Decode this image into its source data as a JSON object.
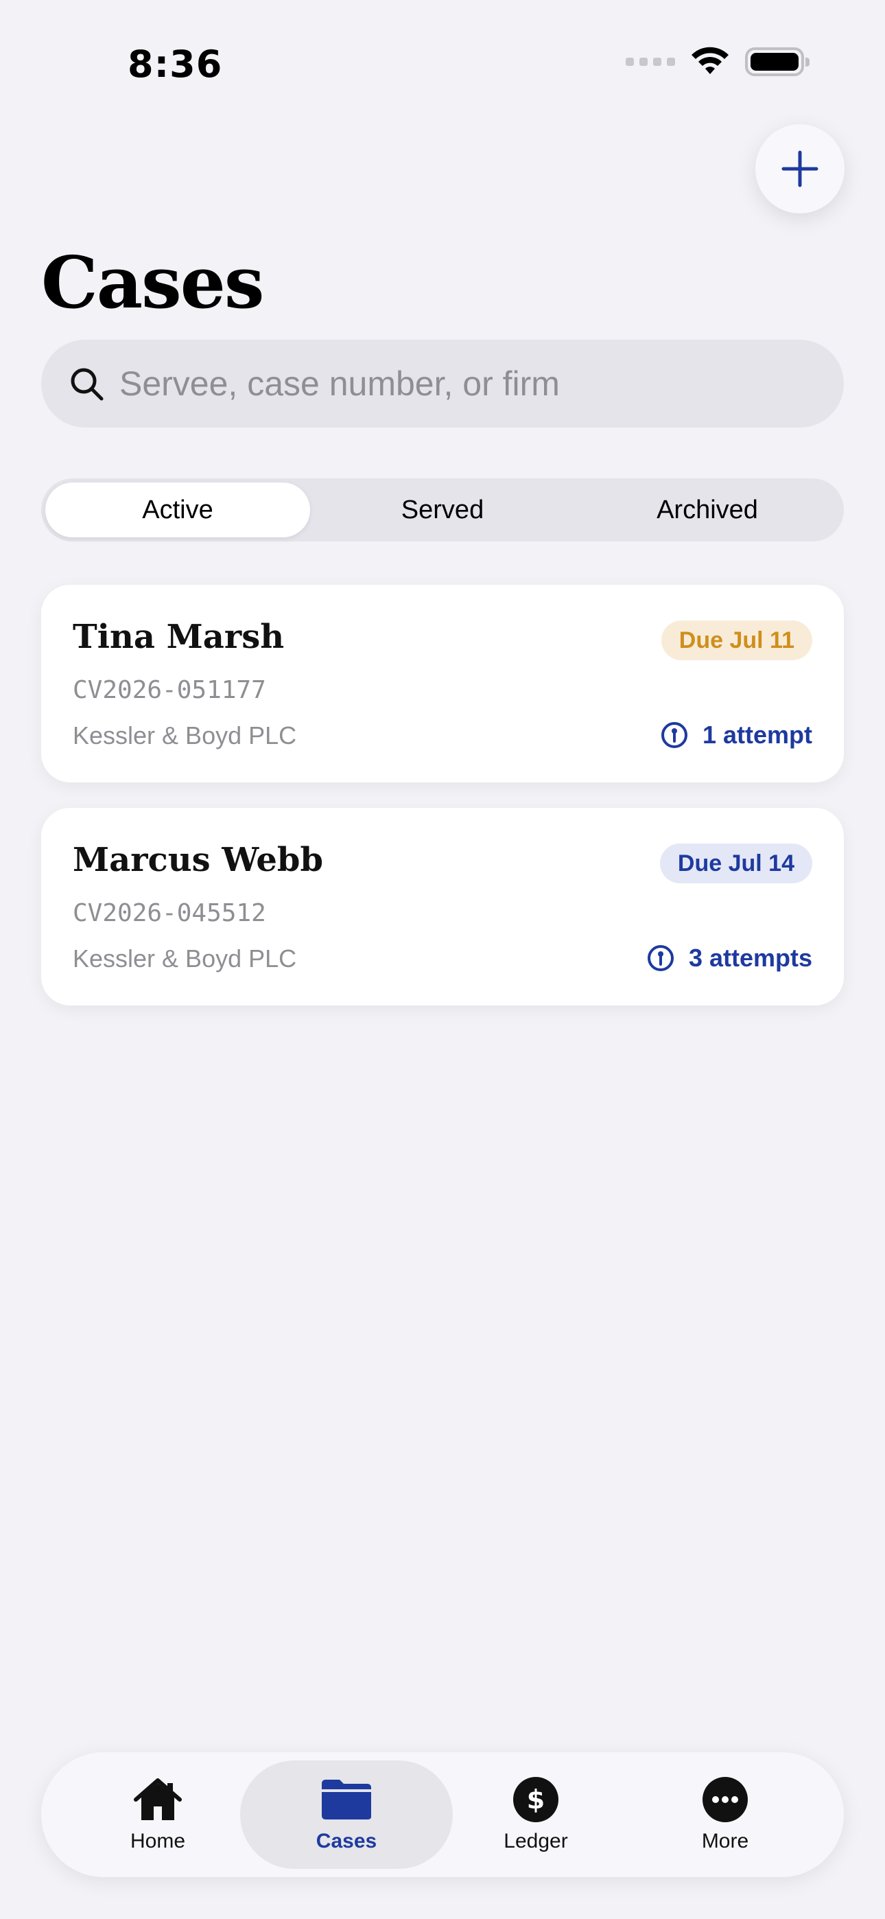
{
  "status_bar": {
    "time": "8:36"
  },
  "header": {
    "title": "Cases"
  },
  "search": {
    "placeholder": "Servee, case number, or firm"
  },
  "segments": [
    {
      "label": "Active",
      "selected": true
    },
    {
      "label": "Served",
      "selected": false
    },
    {
      "label": "Archived",
      "selected": false
    }
  ],
  "cases": [
    {
      "servee": "Tina Marsh",
      "case_number": "CV2026-051177",
      "firm": "Kessler & Boyd PLC",
      "due": "Due Jul 11",
      "due_color": "#d08e1c",
      "attempts": "1 attempt"
    },
    {
      "servee": "Marcus Webb",
      "case_number": "CV2026-045512",
      "firm": "Kessler & Boyd PLC",
      "due": "Due Jul 14",
      "due_color": "#1e3a9f",
      "attempts": "3 attempts"
    }
  ],
  "tabbar": {
    "items": [
      {
        "label": "Home",
        "icon": "home-icon"
      },
      {
        "label": "Cases",
        "icon": "folder-icon",
        "active": true
      },
      {
        "label": "Ledger",
        "icon": "dollar-icon"
      },
      {
        "label": "More",
        "icon": "ellipsis-icon"
      }
    ]
  },
  "colors": {
    "accent": "#1e3a9f",
    "background": "#f2f2f7",
    "warning": "#d08e1c"
  }
}
